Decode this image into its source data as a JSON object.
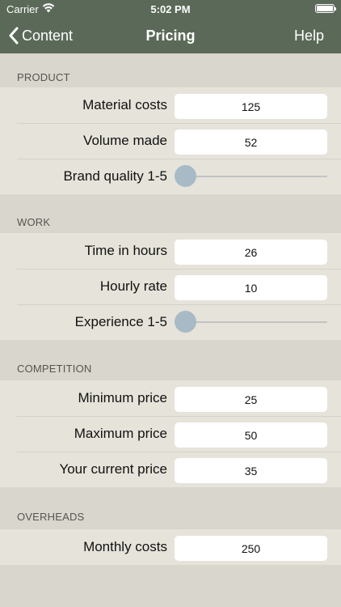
{
  "status_bar": {
    "carrier": "Carrier",
    "time": "5:02 PM"
  },
  "nav": {
    "back_label": "Content",
    "title": "Pricing",
    "help_label": "Help"
  },
  "sections": {
    "product": {
      "header": "PRODUCT",
      "material_costs": {
        "label": "Material costs",
        "value": "125"
      },
      "volume_made": {
        "label": "Volume made",
        "value": "52"
      },
      "brand_quality": {
        "label": "Brand quality 1-5",
        "min": 1,
        "max": 5,
        "value": 1
      }
    },
    "work": {
      "header": "WORK",
      "time_in_hours": {
        "label": "Time in hours",
        "value": "26"
      },
      "hourly_rate": {
        "label": "Hourly rate",
        "value": "10"
      },
      "experience": {
        "label": "Experience 1-5",
        "min": 1,
        "max": 5,
        "value": 1
      }
    },
    "competition": {
      "header": "COMPETITION",
      "minimum_price": {
        "label": "Minimum price",
        "value": "25"
      },
      "maximum_price": {
        "label": "Maximum price",
        "value": "50"
      },
      "current_price": {
        "label": "Your current price",
        "value": "35"
      }
    },
    "overheads": {
      "header": "OVERHEADS",
      "monthly_costs": {
        "label": "Monthly costs",
        "value": "250"
      }
    }
  },
  "colors": {
    "nav_background": "#5b6a58",
    "page_background": "#d9d6ce",
    "row_background": "#e6e3da",
    "slider_thumb": "#a7bac6"
  }
}
